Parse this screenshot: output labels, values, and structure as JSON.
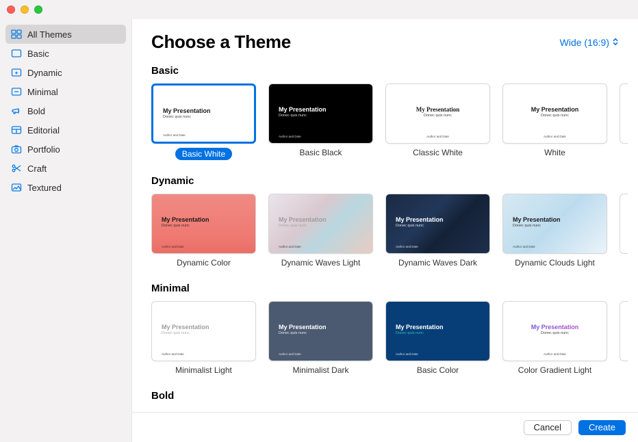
{
  "header": {
    "title": "Choose a Theme",
    "aspect_label": "Wide (16:9)"
  },
  "sidebar": {
    "items": [
      {
        "label": "All Themes",
        "icon": "grid-icon",
        "selected": true
      },
      {
        "label": "Basic",
        "icon": "rect-icon"
      },
      {
        "label": "Dynamic",
        "icon": "sparkle-rect-icon"
      },
      {
        "label": "Minimal",
        "icon": "dash-rect-icon"
      },
      {
        "label": "Bold",
        "icon": "megaphone-icon"
      },
      {
        "label": "Editorial",
        "icon": "layout-icon"
      },
      {
        "label": "Portfolio",
        "icon": "camera-icon"
      },
      {
        "label": "Craft",
        "icon": "scissors-icon"
      },
      {
        "label": "Textured",
        "icon": "texture-icon"
      }
    ]
  },
  "thumb_text": {
    "title": "My Presentation",
    "subtitle": "Donec quis nunc",
    "footer": "Author and Date"
  },
  "sections": [
    {
      "title": "Basic",
      "themes": [
        {
          "name": "Basic White",
          "style": "bg-white",
          "selected": true,
          "titleClass": "dark",
          "align": "left",
          "footerAlign": "footer-left"
        },
        {
          "name": "Basic Black",
          "style": "bg-black",
          "titleClass": "light",
          "align": "left",
          "footerAlign": "footer-left"
        },
        {
          "name": "Classic White",
          "style": "bg-white",
          "titleClass": "dark serif",
          "align": "center",
          "footerAlign": "footer-center"
        },
        {
          "name": "White",
          "style": "bg-white",
          "titleClass": "dark",
          "align": "center",
          "footerAlign": "footer-center"
        }
      ],
      "peek": true
    },
    {
      "title": "Dynamic",
      "themes": [
        {
          "name": "Dynamic Color",
          "style": "bg-dcolor",
          "titleClass": "dark",
          "align": "left",
          "footerAlign": "footer-left"
        },
        {
          "name": "Dynamic Waves Light",
          "style": "bg-dwlight",
          "titleClass": "muted",
          "align": "left",
          "footerAlign": "footer-left"
        },
        {
          "name": "Dynamic Waves Dark",
          "style": "bg-dwdark",
          "titleClass": "light",
          "align": "left",
          "footerAlign": "footer-left"
        },
        {
          "name": "Dynamic Clouds Light",
          "style": "bg-dclight",
          "titleClass": "dark",
          "align": "left",
          "footerAlign": "footer-left"
        }
      ],
      "peek": true
    },
    {
      "title": "Minimal",
      "themes": [
        {
          "name": "Minimalist Light",
          "style": "bg-mlight",
          "titleClass": "muted",
          "align": "left",
          "footerAlign": "footer-left"
        },
        {
          "name": "Minimalist Dark",
          "style": "bg-mdark",
          "titleClass": "light",
          "align": "left",
          "footerAlign": "footer-left"
        },
        {
          "name": "Basic Color",
          "style": "bg-bcolor",
          "titleClass": "light",
          "subClass": "teal",
          "align": "left",
          "footerAlign": "footer-left"
        },
        {
          "name": "Color Gradient Light",
          "style": "bg-cgl",
          "titleClass": "grad",
          "align": "center",
          "footerAlign": "footer-center"
        }
      ],
      "peek": true
    },
    {
      "title": "Bold",
      "themes": []
    }
  ],
  "footer": {
    "cancel_label": "Cancel",
    "create_label": "Create"
  },
  "colors": {
    "accent": "#0071e3"
  }
}
